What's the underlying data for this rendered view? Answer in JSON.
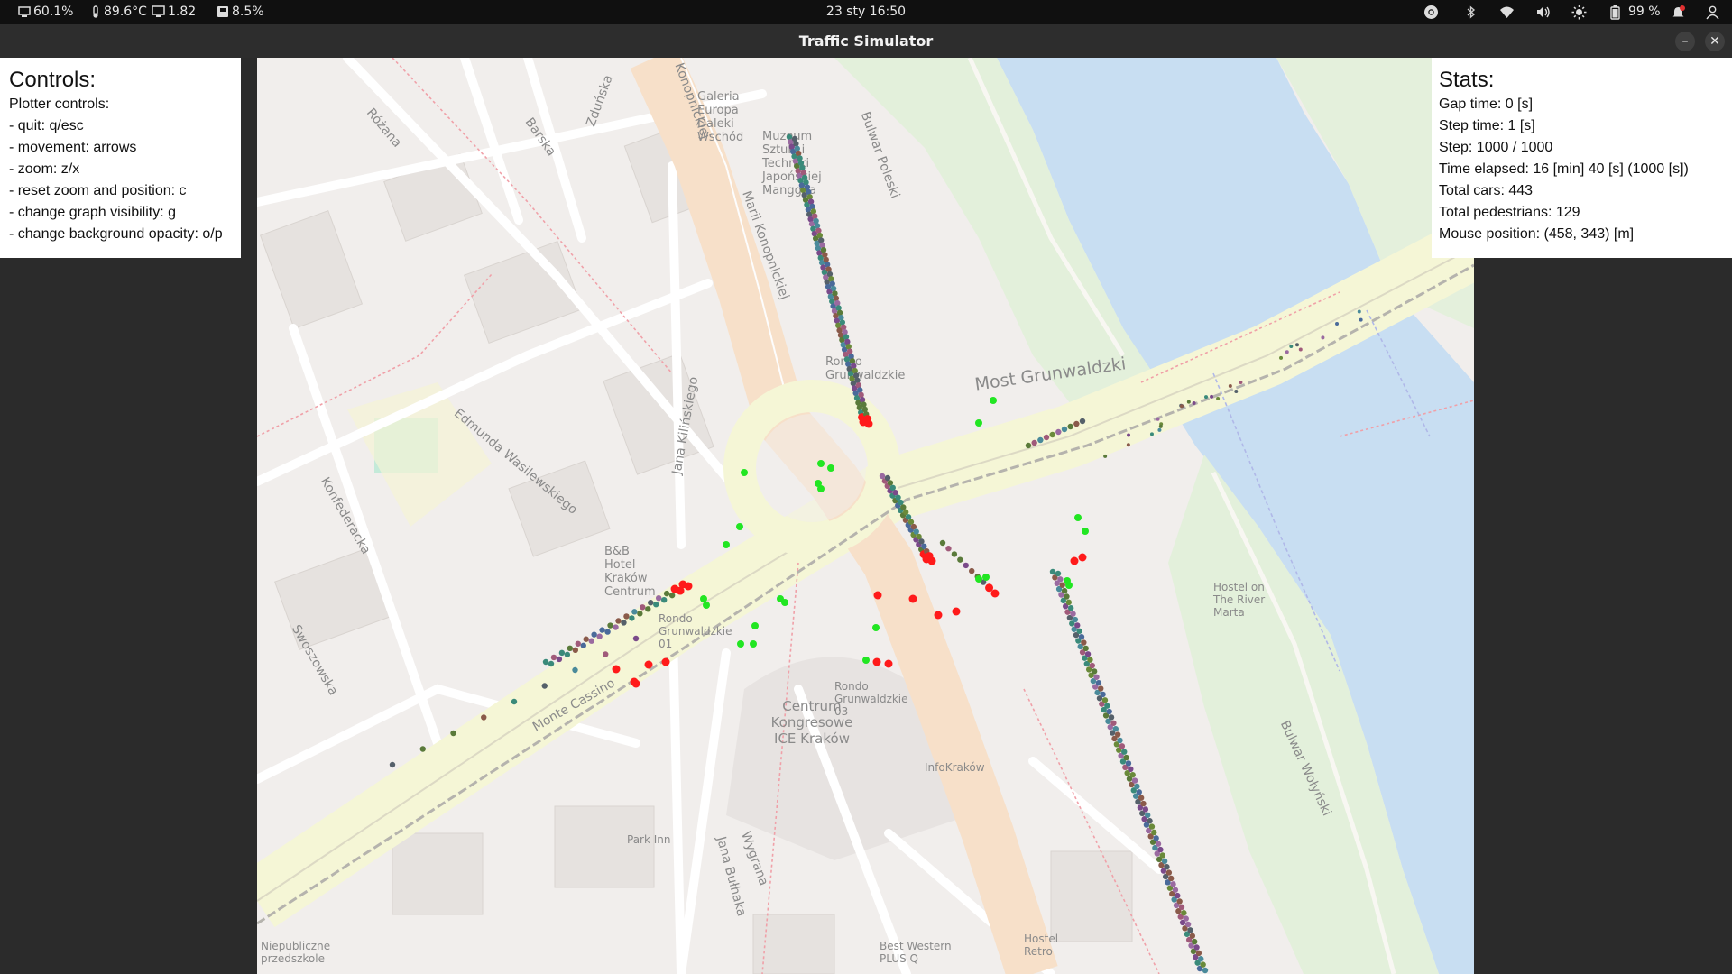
{
  "system_bar": {
    "cpu": "60.1%",
    "temperature": "89.6°C",
    "load": "1.82",
    "memory": "8.5%",
    "clock": "23 sty  16:50",
    "battery": "99 %",
    "icons": [
      "cpu-icon",
      "thermometer-icon",
      "monitor-icon",
      "memory-icon",
      "chrome-icon",
      "bluetooth-icon",
      "wifi-icon",
      "volume-icon",
      "brightness-icon",
      "battery-icon",
      "notification-icon",
      "user-icon"
    ]
  },
  "window": {
    "title": "Traffic Simulator",
    "minimize_label": "–",
    "close_label": "✕"
  },
  "controls": {
    "title": "Controls:",
    "lines": [
      "Plotter controls:",
      " - quit: q/esc",
      " - movement: arrows",
      " - zoom: z/x",
      " - reset zoom and position: c",
      " - change graph visibility: g",
      " - change background opacity: o/p"
    ]
  },
  "stats": {
    "title": "Stats:",
    "lines": [
      "Gap time: 0 [s]",
      "Step time: 1 [s]",
      "Step: 1000 / 1000",
      "Time elapsed: 16 [min] 40 [s] (1000 [s])",
      "Total cars: 443",
      "Total pedestrians: 129",
      "Mouse position: (458, 343) [m]"
    ]
  },
  "map": {
    "labels": [
      "Konopnickiej",
      "Galeria Europa Daleki Wschód",
      "Muzeum Sztuki i Techniki Japońskiej Manggha",
      "Bulwar Poleski",
      "Most Grunwaldzki",
      "Rondo Grunwaldzkie",
      "Marii Konopnickiej",
      "Jana Kilińskiego",
      "Edmunda Wasilewskiego",
      "Konfederacka",
      "Monte Cassino",
      "B&B Hotel Kraków Centrum",
      "Rondo Grunwaldzkie 01",
      "Rondo Grunwaldzkie 03",
      "Centrum Kongresowe ICE Kraków",
      "InfoKraków",
      "Hostel on The River Marta",
      "Bulwar Wołyński",
      "Jana Bułhaka",
      "Wygrana",
      "Park Inn",
      "Best Western PLUS Q",
      "Hostel Retro",
      "Niepubliczne przedszkole",
      "Barska",
      "Zduńska",
      "Różana",
      "Swoszowska"
    ]
  },
  "colors": {
    "road_major": "#f7e0c9",
    "road_secondary": "#f5f6d6",
    "water": "#c5dcf1",
    "park": "#e4f1dc",
    "car_stopped": "#ff1a1a",
    "pedestrian": "#22e622"
  }
}
